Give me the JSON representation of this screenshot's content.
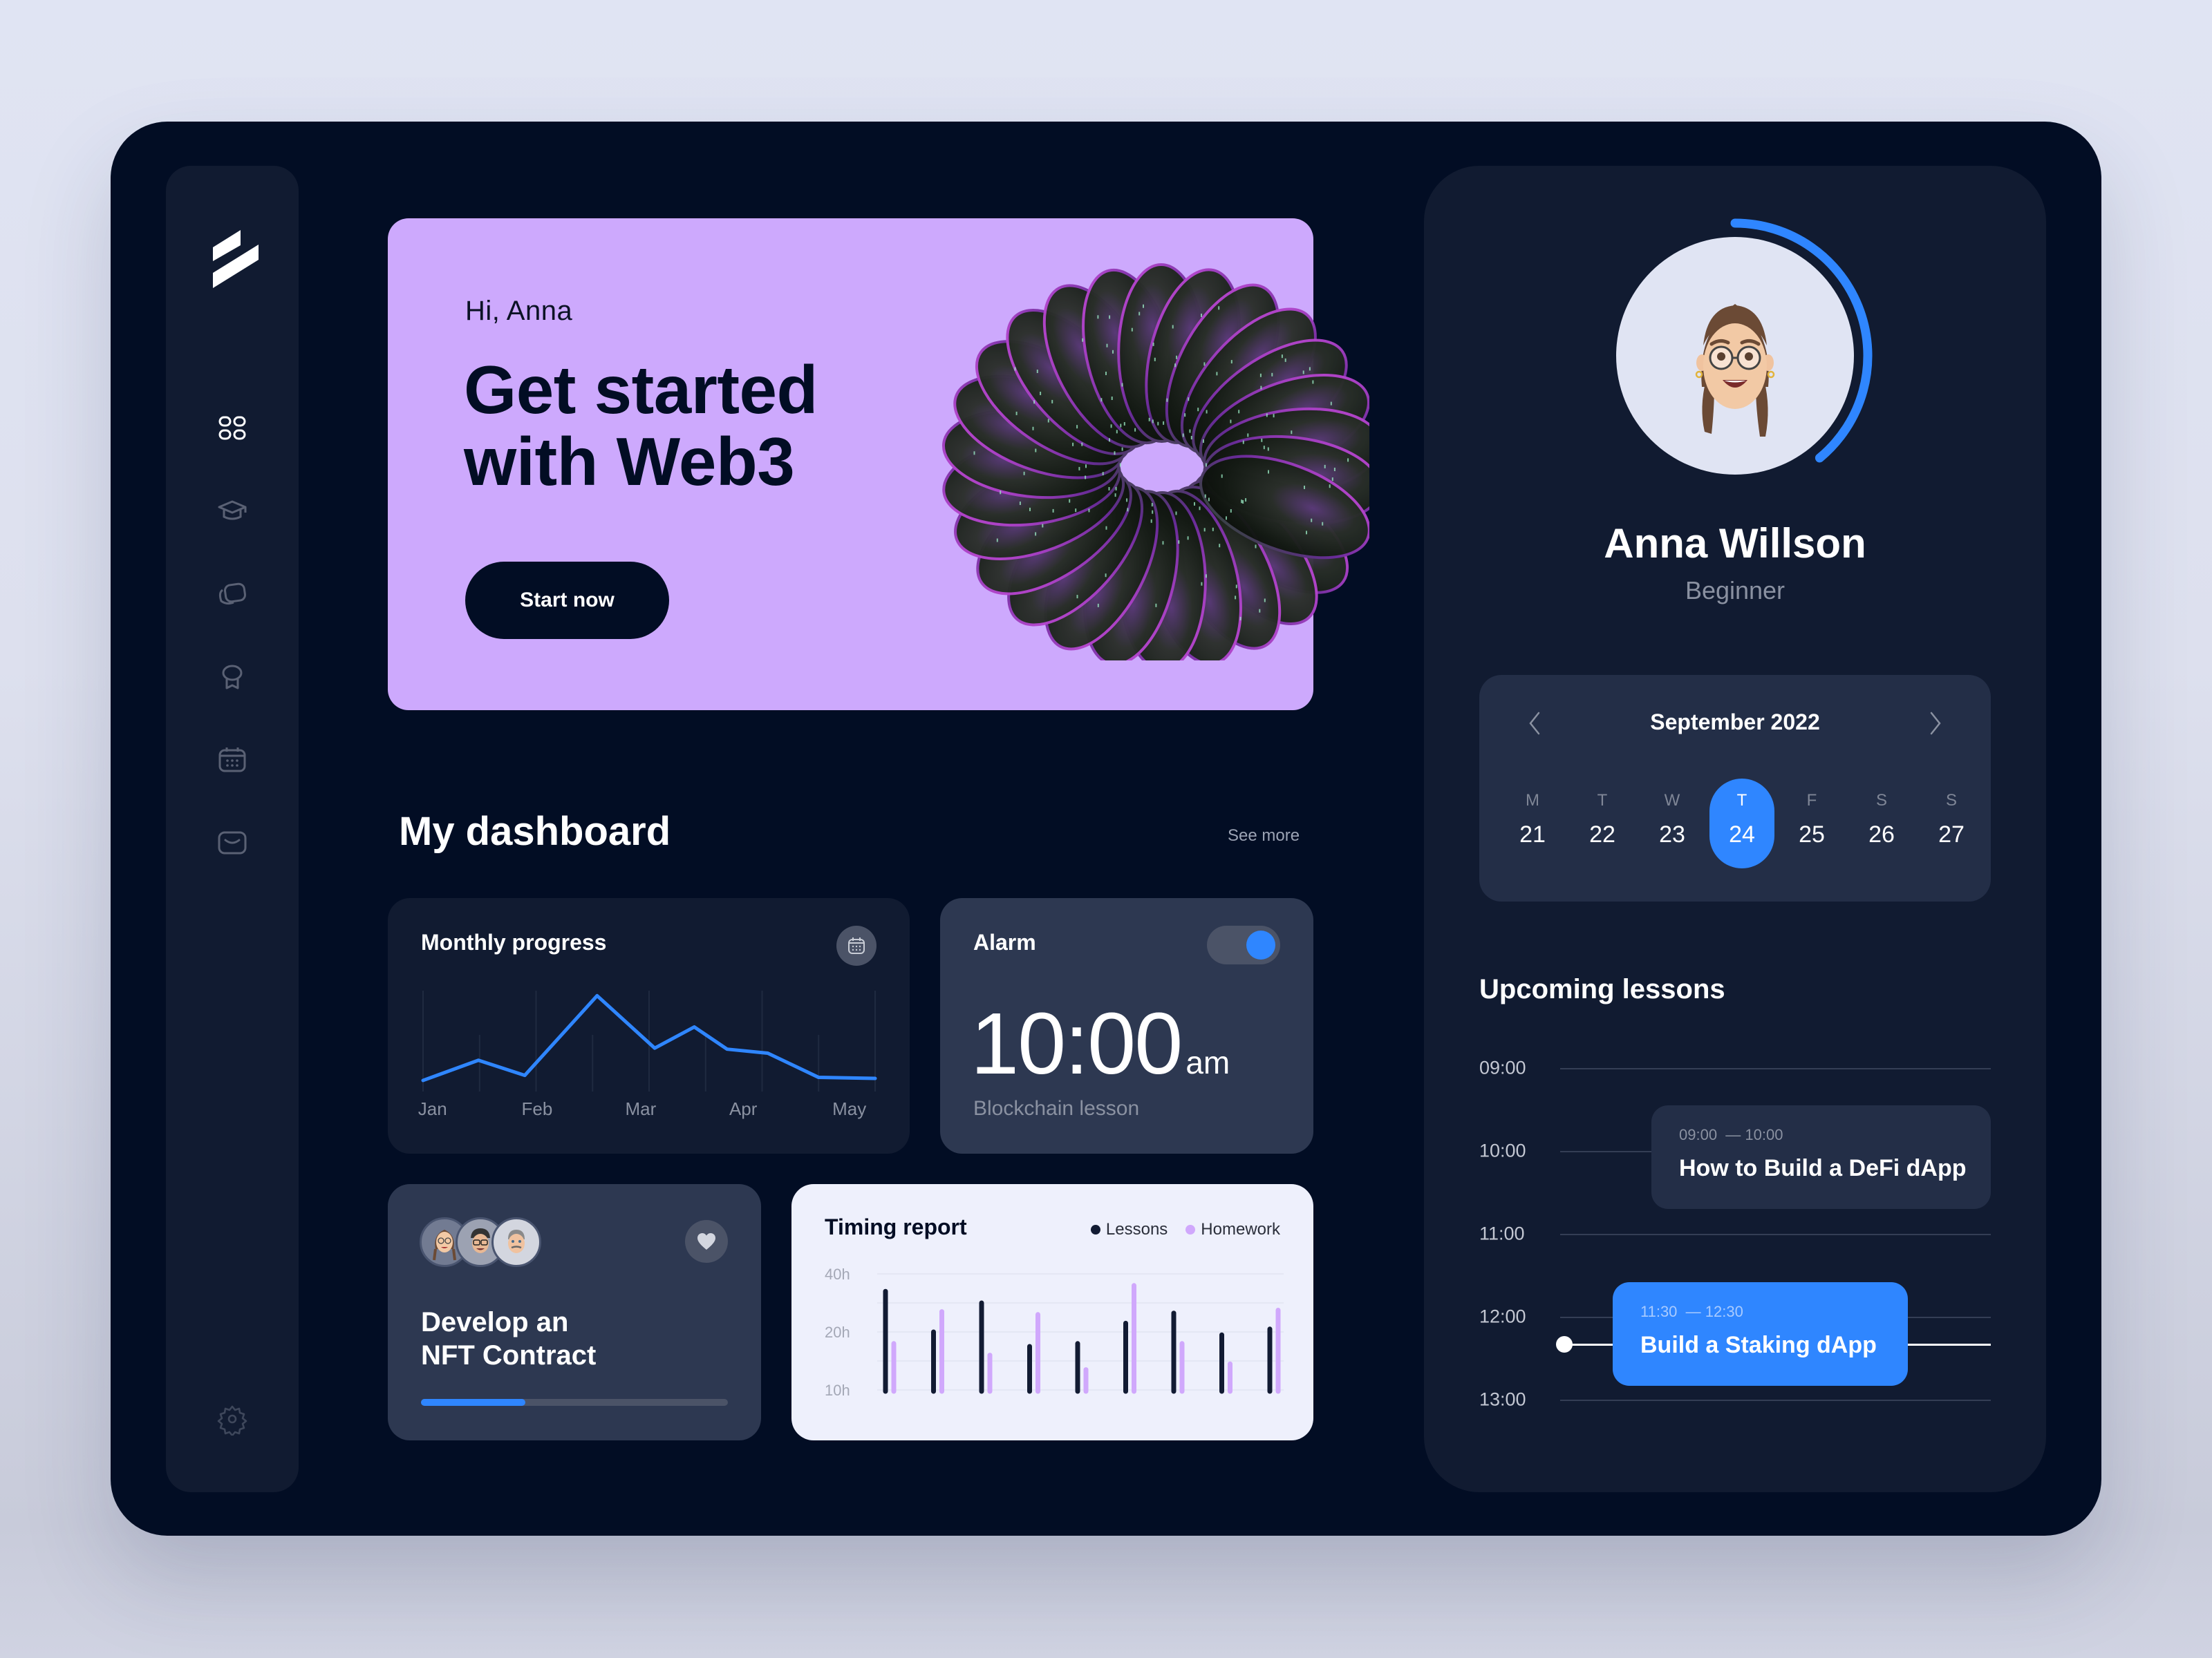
{
  "colors": {
    "accent": "#2F86FF",
    "banner": "#CDA9FD",
    "frame": "#020D24",
    "panel": "#111B31",
    "card": "#2D3851",
    "lessons_bar": "#121B33",
    "homework_bar": "#D0A8FC"
  },
  "sidebar": {
    "logo": "brand-logo",
    "items": [
      {
        "icon": "grid-icon",
        "label": "Dashboard",
        "active": true
      },
      {
        "icon": "graduation-cap-icon",
        "label": "Courses",
        "active": false
      },
      {
        "icon": "cards-icon",
        "label": "Collections",
        "active": false
      },
      {
        "icon": "award-icon",
        "label": "Achievements",
        "active": false
      },
      {
        "icon": "calendar-icon",
        "label": "Calendar",
        "active": false
      },
      {
        "icon": "mail-icon",
        "label": "Messages",
        "active": false
      }
    ],
    "settings_icon": "gear-icon"
  },
  "banner": {
    "greeting": "Hi, Anna",
    "headline_line1": "Get started",
    "headline_line2": "with Web3",
    "cta_label": "Start now"
  },
  "dashboard": {
    "title": "My dashboard",
    "see_more": "See more",
    "monthly_progress": {
      "title": "Monthly progress",
      "calendar_icon": "calendar-icon"
    },
    "alarm": {
      "title": "Alarm",
      "enabled": true,
      "time": "10:00",
      "period": "am",
      "subtitle": "Blockchain lesson"
    },
    "course": {
      "title_line1": "Develop an",
      "title_line2": "NFT Contract",
      "progress": 0.34,
      "participants": [
        "participant-1",
        "participant-2",
        "participant-3"
      ],
      "favorite_icon": "heart-icon"
    },
    "timing_report": {
      "title": "Timing report"
    }
  },
  "profile": {
    "name": "Anna Willson",
    "level": "Beginner",
    "level_progress": 0.39
  },
  "calendar": {
    "month_label": "September 2022",
    "prev_icon": "chevron-left-icon",
    "next_icon": "chevron-right-icon",
    "days": [
      {
        "name": "M",
        "date": "21",
        "selected": false
      },
      {
        "name": "T",
        "date": "22",
        "selected": false
      },
      {
        "name": "W",
        "date": "23",
        "selected": false
      },
      {
        "name": "T",
        "date": "24",
        "selected": true
      },
      {
        "name": "F",
        "date": "25",
        "selected": false
      },
      {
        "name": "S",
        "date": "26",
        "selected": false
      },
      {
        "name": "S",
        "date": "27",
        "selected": false
      }
    ]
  },
  "upcoming": {
    "title": "Upcoming lessons",
    "hours": [
      "09:00",
      "10:00",
      "11:00",
      "12:00",
      "13:00"
    ],
    "current_time": "12:20",
    "lessons": [
      {
        "time_range": "09:00  — 10:00",
        "start": "09:00",
        "end": "10:00",
        "name": "How to Build a DeFi dApp",
        "highlighted": false
      },
      {
        "time_range": "11:30  — 12:30",
        "start": "11:30",
        "end": "12:30",
        "name": "Build a Staking dApp",
        "highlighted": true
      }
    ]
  },
  "chart_data": [
    {
      "type": "line",
      "title": "Monthly progress",
      "xlabel": "",
      "ylabel": "",
      "x_tick_labels": [
        "Jan",
        "Feb",
        "Mar",
        "Apr",
        "May"
      ],
      "x_range": [
        0,
        4
      ],
      "y_range": [
        0,
        100
      ],
      "grid": "vertical",
      "series": [
        {
          "name": "Progress",
          "color": "#2F86FF",
          "x": [
            0,
            0.49,
            0.9,
            1.54,
            2.05,
            2.4,
            2.69,
            3.05,
            3.5,
            4.0
          ],
          "y": [
            11,
            31,
            16,
            95,
            43,
            64,
            42,
            38,
            14,
            13
          ]
        }
      ]
    },
    {
      "type": "bar",
      "title": "Timing report",
      "xlabel": "",
      "ylabel": "",
      "y_tick_labels": [
        "40h",
        "20h",
        "10h"
      ],
      "y_ticks": [
        40,
        20,
        10
      ],
      "y_range": [
        10,
        40
      ],
      "grid": "horizontal",
      "legend": "top-right",
      "categories": [
        "1",
        "2",
        "3",
        "4",
        "5",
        "6",
        "7",
        "8",
        "9"
      ],
      "series": [
        {
          "name": "Lessons",
          "color": "#121B33",
          "values": [
            34,
            20,
            30,
            17.5,
            18,
            23,
            26.5,
            19.5,
            21
          ]
        },
        {
          "name": "Homework",
          "color": "#D0A8FC",
          "values": [
            18,
            27,
            16,
            26,
            13.5,
            36,
            18,
            14.5,
            27.5
          ]
        }
      ]
    }
  ]
}
